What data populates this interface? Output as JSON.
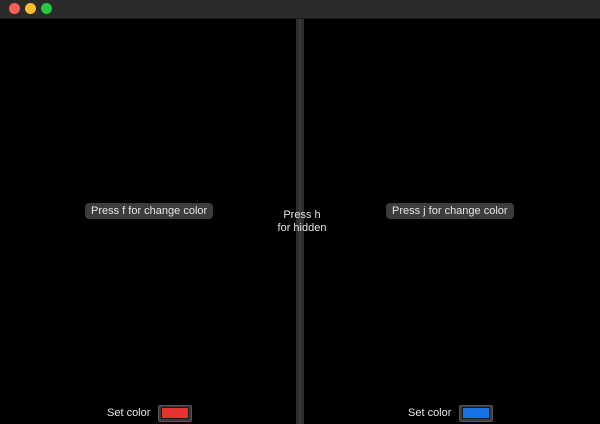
{
  "window": {
    "traffic_lights": [
      "close",
      "minimize",
      "maximize"
    ]
  },
  "left_pane": {
    "hint_label": "Press f for change color",
    "set_color_label": "Set color",
    "color": "#e8322f"
  },
  "right_pane": {
    "hint_label": "Press j for change color",
    "set_color_label": "Set color",
    "color": "#1673e6"
  },
  "center_hint": {
    "line1": "Press h",
    "line2": "for hidden"
  },
  "colors": {
    "background": "#000000",
    "titlebar": "#2b2b2b",
    "divider": "#2e2e2e",
    "hint_button_bg": "#3c3c3c",
    "text": "#e6e6e6"
  }
}
